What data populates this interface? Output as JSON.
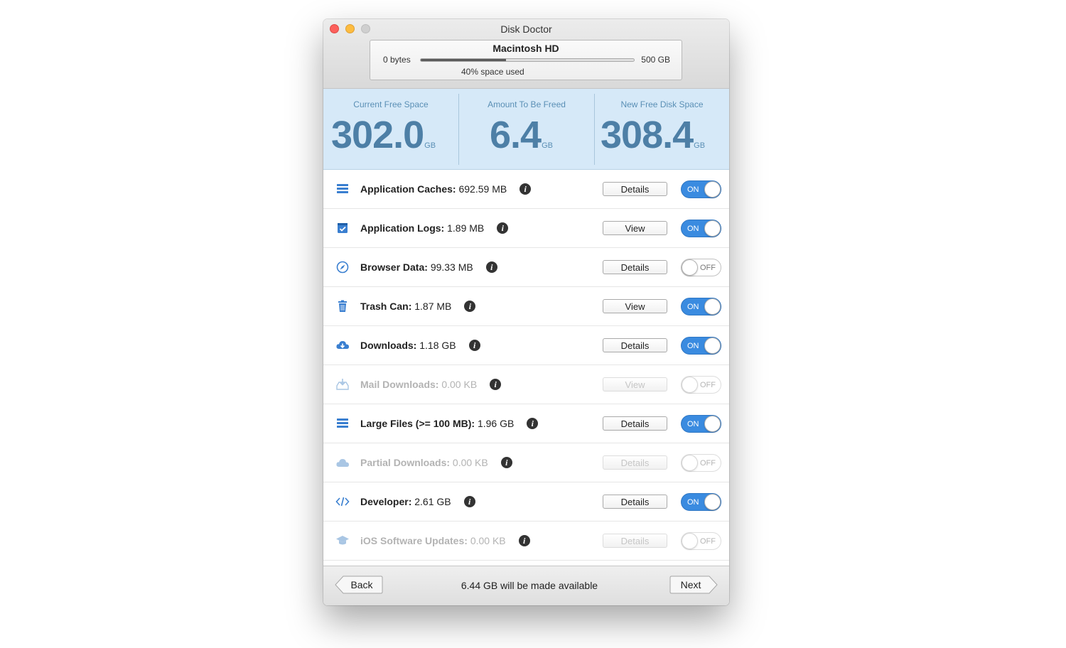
{
  "window": {
    "title": "Disk Doctor"
  },
  "disk": {
    "name": "Macintosh HD",
    "min_label": "0 bytes",
    "max_label": "500 GB",
    "used_text": "40% space used",
    "used_fraction": 0.4
  },
  "stats": [
    {
      "label": "Current Free Space",
      "value": "302.0",
      "unit": "GB"
    },
    {
      "label": "Amount To Be Freed",
      "value": "6.4",
      "unit": "GB"
    },
    {
      "label": "New Free Disk Space",
      "value": "308.4",
      "unit": "GB"
    }
  ],
  "rows": [
    {
      "name": "Application Caches:",
      "size": "692.59 MB",
      "button": "Details",
      "toggle": "ON",
      "enabled": true,
      "icon": "stack-icon"
    },
    {
      "name": "Application Logs:",
      "size": "1.89 MB",
      "button": "View",
      "toggle": "ON",
      "enabled": true,
      "icon": "calendar-check-icon"
    },
    {
      "name": "Browser Data:",
      "size": "99.33 MB",
      "button": "Details",
      "toggle": "OFF",
      "enabled": true,
      "icon": "compass-icon"
    },
    {
      "name": "Trash Can:",
      "size": "1.87 MB",
      "button": "View",
      "toggle": "ON",
      "enabled": true,
      "icon": "trash-icon"
    },
    {
      "name": "Downloads:",
      "size": "1.18 GB",
      "button": "Details",
      "toggle": "ON",
      "enabled": true,
      "icon": "cloud-download-icon"
    },
    {
      "name": "Mail Downloads:",
      "size": "0.00 KB",
      "button": "View",
      "toggle": "OFF",
      "enabled": false,
      "icon": "tray-download-icon"
    },
    {
      "name": "Large Files (>= 100 MB):",
      "size": "1.96 GB",
      "button": "Details",
      "toggle": "ON",
      "enabled": true,
      "icon": "stack-icon"
    },
    {
      "name": "Partial Downloads:",
      "size": "0.00 KB",
      "button": "Details",
      "toggle": "OFF",
      "enabled": false,
      "icon": "cloud-icon"
    },
    {
      "name": "Developer:",
      "size": "2.61 GB",
      "button": "Details",
      "toggle": "ON",
      "enabled": true,
      "icon": "code-icon"
    },
    {
      "name": "iOS Software Updates:",
      "size": "0.00 KB",
      "button": "Details",
      "toggle": "OFF",
      "enabled": false,
      "icon": "graduation-cap-icon"
    }
  ],
  "info_glyph": "i",
  "footer": {
    "back": "Back",
    "next": "Next",
    "message": "6.44 GB will be made available"
  },
  "colors": {
    "accent": "#3a8be0",
    "stats_bg": "#d6e9f8",
    "stats_text": "#4d7fa6",
    "icon_blue": "#3a7fd0",
    "disabled_text": "#b3b3b3"
  }
}
